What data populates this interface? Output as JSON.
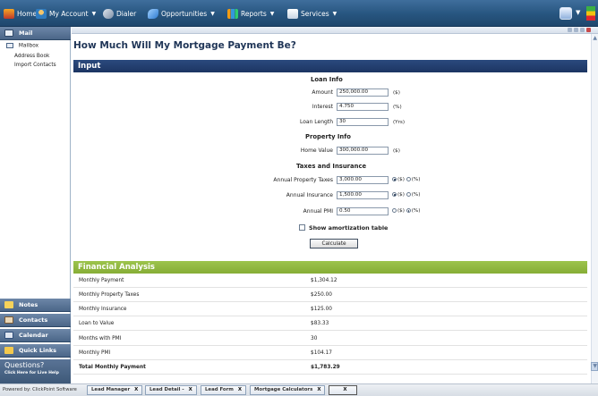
{
  "nav": {
    "home": "Home",
    "account": "My Account",
    "dialer": "Dialer",
    "opportunities": "Opportunities",
    "reports": "Reports",
    "services": "Services",
    "caret": "▼"
  },
  "sidebar": {
    "mail_title": "Mail",
    "mail_items": [
      "Mailbox",
      "Address Book",
      "Import Contacts"
    ],
    "sections": [
      "Notes",
      "Contacts",
      "Calendar",
      "Quick Links"
    ],
    "help_title": "Questions?",
    "help_sub": "Click Here for Live Help"
  },
  "page": {
    "title": "How Much Will My Mortgage Payment Be?"
  },
  "input": {
    "band": "Input",
    "loan_info_title": "Loan Info",
    "amount_label": "Amount",
    "amount_value": "250,000.00",
    "amount_unit": "($)",
    "interest_label": "Interest",
    "interest_value": "4.750",
    "interest_unit": "(%)",
    "length_label": "Loan Length",
    "length_value": "30",
    "length_unit": "(Yrs)",
    "property_title": "Property Info",
    "home_value_label": "Home Value",
    "home_value": "300,000.00",
    "home_value_unit": "($)",
    "taxes_title": "Taxes and Insurance",
    "tax_label": "Annual Property Taxes",
    "tax_value": "3,000.00",
    "ins_label": "Annual Insurance",
    "ins_value": "1,500.00",
    "pmi_label": "Annual PMI",
    "pmi_value": "0.50",
    "unit_dollar": "($)",
    "unit_percent": "(%)",
    "amort_label": "Show amortization table",
    "calc_label": "Calculate"
  },
  "financial": {
    "band": "Financial Analysis",
    "rows": [
      {
        "label": "Monthly Payment",
        "value": "$1,304.12"
      },
      {
        "label": "Monthly Property Taxes",
        "value": "$250.00"
      },
      {
        "label": "Monthly Insurance",
        "value": "$125.00"
      },
      {
        "label": "Loan to Value",
        "value": "$83.33"
      },
      {
        "label": "Months with PMI",
        "value": "30"
      },
      {
        "label": "Monthly PMI",
        "value": "$104.17"
      }
    ],
    "total_label": "Total Monthly Payment",
    "total_value": "$1,783.29"
  },
  "bottombar": {
    "powered": "Powered by: ClickPoint Software",
    "tabs": [
      "Lead Manager",
      "Lead Detail -",
      "Lead Form",
      "Mortgage Calculators",
      ""
    ],
    "close": "X"
  },
  "colors": {
    "nav_bg": "#27557f",
    "input_band": "#1c3562",
    "finance_band": "#86ad36",
    "title": "#1f3557"
  }
}
